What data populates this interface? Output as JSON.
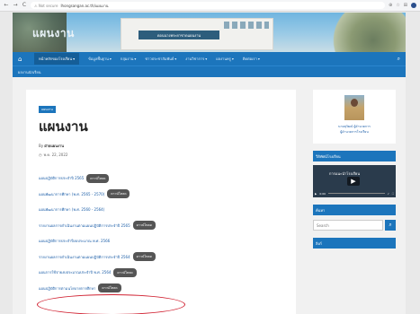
{
  "browser": {
    "back": "←",
    "forward": "→",
    "reload": "C",
    "url_warning": "⚠ Not secure",
    "url": "lhongsangan.ac.th/แผนงาน"
  },
  "banner": {
    "site_name": "แผนงาน",
    "sign_text": "ดอนนางพระยาชาดแผนงาน"
  },
  "navbar": {
    "items": [
      {
        "label": "หน้าหลักของโรงเรียน",
        "caret": "▾"
      },
      {
        "label": "ข้อมูลพื้นฐาน",
        "caret": "▾"
      },
      {
        "label": "กลุ่มงาน",
        "caret": "▾"
      },
      {
        "label": "ข่าวประชาสัมพันธ์",
        "caret": "▾"
      },
      {
        "label": "งานวิชาการ",
        "caret": "▾"
      },
      {
        "label": "ผลงานครู",
        "caret": "▾"
      },
      {
        "label": "ติดต่อเรา",
        "caret": "▾"
      }
    ],
    "row2_item": "ผลงานนักเรียน",
    "home_icon": "⌂",
    "search_icon": "⌕"
  },
  "article": {
    "category": "แผนงาน",
    "title": "แผนงาน",
    "author_prefix": "By",
    "author": "ฝ่ายแผนงาน",
    "date": "พ.ค. 22, 2022",
    "plans": [
      {
        "title": "แผนปฏิบัติการประจำปี 2565",
        "button": "ดาวน์โหลด"
      },
      {
        "title": "แผนพัฒนาการศึกษา (พ.ศ. 2565 - 2570)",
        "button": "ดาวน์โหลด"
      },
      {
        "title": "แผนพัฒนาการศึกษา (พ.ศ. 2560 - 2564)",
        "button": ""
      },
      {
        "title": "รายงานผลการดำเนินงานตามแผนปฏิบัติการประจำปี 2565",
        "button": "ดาวน์โหลด"
      },
      {
        "title": "แผนปฏิบัติการประจำปีงบประมาณ พ.ศ. 2566",
        "button": ""
      },
      {
        "title": "รายงานผลการดำเนินงานตามแผนปฏิบัติการประจำปี 2564",
        "button": "ดาวน์โหลด"
      },
      {
        "title": "แผนการใช้จ่ายงบประมาณประจำปี พ.ศ. 2564",
        "button": "ดาวน์โหลด"
      },
      {
        "title": "แผนปฏิบัติการตามนโยบายการศึกษา",
        "button": "ดาวน์โหลด"
      }
    ]
  },
  "sidebar": {
    "profile_name": "นายสุวัฒน์ ผู้อำนวยการ",
    "profile_role": "ผู้อำนวยการโรงเรียน",
    "video_widget_title": "วีดิทัศน์โรงเรียน",
    "video_title": "การแนะนำโรงเรียน",
    "play_icon": "▶",
    "video_time": "0:00",
    "search_widget_title": "ค้นหา",
    "search_placeholder": "Search",
    "search_icon": "⌕",
    "widget3_title": "ลิงก์"
  },
  "colors": {
    "nav_blue": "#1c75bc",
    "highlight_red": "#d02030",
    "button_gray": "#555555"
  }
}
